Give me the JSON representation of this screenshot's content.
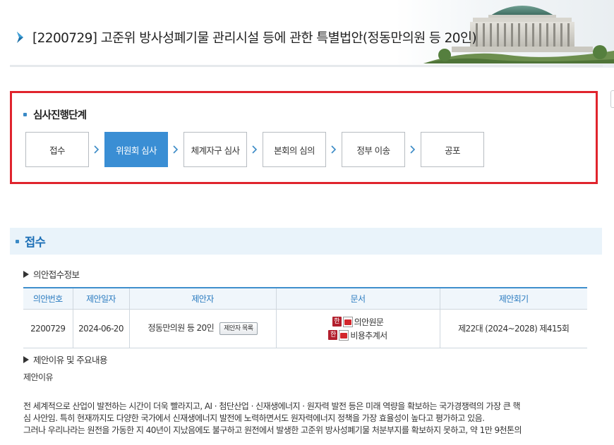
{
  "header": {
    "title": "[2200729] 고준위 방사성폐기물 관리시설 등에 관한 특별법안(정동만의원 등 20인)"
  },
  "stages": {
    "heading": "심사진행단계",
    "items": [
      {
        "label": "접수",
        "active": false
      },
      {
        "label": "위원회 심사",
        "active": true
      },
      {
        "label": "체계자구 심사",
        "active": false
      },
      {
        "label": "본회의 심의",
        "active": false
      },
      {
        "label": "정부 이송",
        "active": false
      },
      {
        "label": "공포",
        "active": false
      }
    ]
  },
  "section": {
    "title": "접수"
  },
  "receipt_info": {
    "heading": "의안접수정보",
    "columns": [
      "의안번호",
      "제안일자",
      "제안자",
      "문서",
      "제안회기"
    ],
    "row": {
      "bill_no": "2200729",
      "date": "2024-06-20",
      "proposer": "정동만의원 등 20인",
      "proposer_button": "제안자 목록",
      "docs": [
        "의안원문",
        "비용추계서"
      ],
      "session": "제22대 (2024~2028) 제415회"
    }
  },
  "reason": {
    "heading": "제안이유 및 주요내용",
    "subtitle": "제안이유",
    "lines": [
      "전 세계적으로 산업이 발전하는 시간이 더욱 빨라지고, AI · 첨단산업 · 신재생에너지 · 원자력 발전 등은 미래 역량을 확보하는 국가경쟁력의 가장 큰 핵",
      "심 사안임. 특히 현재까지도 다양한 국가에서 신재생에너지 발전에 노력하면서도 원자력에너지 정책을 가장 효율성이 높다고 평가하고 있음.",
      "그러나 우리나라는 원전을 가동한 지 40년이 지났음에도 불구하고 원전에서 발생한 고준위 방사성폐기물 처분부지를 확보하지 못하고, 약 1만 9천톤의"
    ]
  },
  "colors": {
    "accent": "#3a8ed4",
    "highlight_border": "#e0242d",
    "section_title": "#1c6fb6"
  }
}
